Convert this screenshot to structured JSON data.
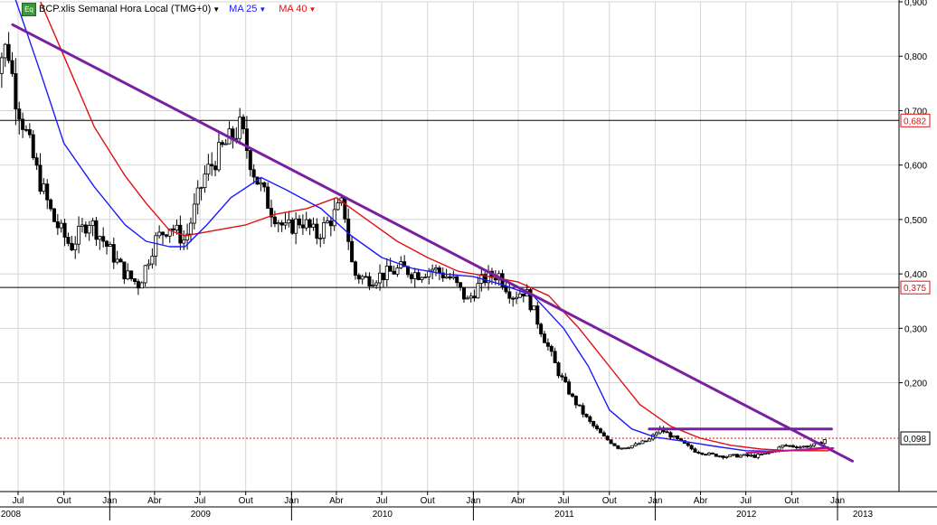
{
  "chart_data": {
    "type": "candlestick",
    "title": "BCP.xlis Semanal Hora Local (TMG+0)",
    "legend": [
      {
        "name": "MA 25",
        "color": "#1a1aff"
      },
      {
        "name": "MA 40",
        "color": "#e01010"
      }
    ],
    "ylim": [
      0.0,
      0.9
    ],
    "y_ticks": [
      "0,900",
      "0,800",
      "0,700",
      "0,600",
      "0,500",
      "0,400",
      "0,300",
      "0,200"
    ],
    "x_month_labels": [
      "Jul",
      "Out",
      "Jan",
      "Abr",
      "Jul",
      "Out",
      "Jan",
      "Abr",
      "Jul",
      "Out",
      "Jan",
      "Abr",
      "Jul",
      "Out",
      "Jan",
      "Abr",
      "Jul",
      "Out",
      "Jan"
    ],
    "x_year_labels": [
      "2008",
      "2009",
      "2010",
      "2011",
      "2012",
      "2013"
    ],
    "grid": true,
    "horizontal_levels": [
      {
        "value": 0.682,
        "label": "0,682",
        "style": "solid",
        "color": "#000000"
      },
      {
        "value": 0.375,
        "label": "0,375",
        "style": "solid",
        "color": "#000000"
      },
      {
        "value": 0.098,
        "label": "0,098",
        "style": "dotted",
        "color": "#e01010"
      }
    ],
    "trendlines": [
      {
        "name": "downtrend",
        "color": "#7a1fa0",
        "from": {
          "date": "2008-06-20",
          "value": 0.858
        },
        "to": {
          "date": "2013-01-31",
          "value": 0.056
        }
      },
      {
        "name": "resistance",
        "color": "#7a1fa0",
        "from": {
          "date": "2011-12-20",
          "value": 0.115
        },
        "to": {
          "date": "2012-12-20",
          "value": 0.115
        }
      }
    ],
    "close_path": [
      {
        "date": "2008-05-01",
        "value": 0.76
      },
      {
        "date": "2008-06-10",
        "value": 0.82
      },
      {
        "date": "2008-06-25",
        "value": 0.73
      },
      {
        "date": "2008-08-10",
        "value": 0.58
      },
      {
        "date": "2008-09-10",
        "value": 0.5
      },
      {
        "date": "2008-10-15",
        "value": 0.45
      },
      {
        "date": "2008-11-20",
        "value": 0.5
      },
      {
        "date": "2008-12-20",
        "value": 0.46
      },
      {
        "date": "2009-02-01",
        "value": 0.4
      },
      {
        "date": "2009-03-01",
        "value": 0.38
      },
      {
        "date": "2009-04-01",
        "value": 0.46
      },
      {
        "date": "2009-05-01",
        "value": 0.49
      },
      {
        "date": "2009-06-01",
        "value": 0.46
      },
      {
        "date": "2009-07-10",
        "value": 0.58
      },
      {
        "date": "2009-08-15",
        "value": 0.63
      },
      {
        "date": "2009-09-20",
        "value": 0.67
      },
      {
        "date": "2009-10-20",
        "value": 0.58
      },
      {
        "date": "2009-11-20",
        "value": 0.52
      },
      {
        "date": "2009-12-20",
        "value": 0.48
      },
      {
        "date": "2010-01-20",
        "value": 0.5
      },
      {
        "date": "2010-02-20",
        "value": 0.47
      },
      {
        "date": "2010-03-20",
        "value": 0.5
      },
      {
        "date": "2010-04-15",
        "value": 0.53
      },
      {
        "date": "2010-05-05",
        "value": 0.4
      },
      {
        "date": "2010-06-01",
        "value": 0.39
      },
      {
        "date": "2010-07-10",
        "value": 0.4
      },
      {
        "date": "2010-08-10",
        "value": 0.41
      },
      {
        "date": "2010-09-10",
        "value": 0.4
      },
      {
        "date": "2010-10-10",
        "value": 0.41
      },
      {
        "date": "2010-11-20",
        "value": 0.39
      },
      {
        "date": "2010-12-20",
        "value": 0.35
      },
      {
        "date": "2011-01-20",
        "value": 0.39
      },
      {
        "date": "2011-02-20",
        "value": 0.4
      },
      {
        "date": "2011-03-20",
        "value": 0.36
      },
      {
        "date": "2011-04-15",
        "value": 0.37
      },
      {
        "date": "2011-05-20",
        "value": 0.29
      },
      {
        "date": "2011-06-20",
        "value": 0.22
      },
      {
        "date": "2011-07-20",
        "value": 0.17
      },
      {
        "date": "2011-08-20",
        "value": 0.13
      },
      {
        "date": "2011-09-20",
        "value": 0.1
      },
      {
        "date": "2011-10-20",
        "value": 0.08
      },
      {
        "date": "2011-11-20",
        "value": 0.085
      },
      {
        "date": "2011-12-20",
        "value": 0.095
      },
      {
        "date": "2012-01-10",
        "value": 0.115
      },
      {
        "date": "2012-02-15",
        "value": 0.095
      },
      {
        "date": "2012-03-20",
        "value": 0.075
      },
      {
        "date": "2012-04-20",
        "value": 0.068
      },
      {
        "date": "2012-05-20",
        "value": 0.065
      },
      {
        "date": "2012-06-20",
        "value": 0.066
      },
      {
        "date": "2012-07-20",
        "value": 0.065
      },
      {
        "date": "2012-08-20",
        "value": 0.072
      },
      {
        "date": "2012-09-15",
        "value": 0.085
      },
      {
        "date": "2012-10-20",
        "value": 0.082
      },
      {
        "date": "2012-11-20",
        "value": 0.086
      },
      {
        "date": "2012-12-10",
        "value": 0.098
      }
    ],
    "ma25_path": [
      {
        "date": "2008-06-20",
        "value": 0.92
      },
      {
        "date": "2008-08-15",
        "value": 0.77
      },
      {
        "date": "2008-10-01",
        "value": 0.64
      },
      {
        "date": "2008-12-01",
        "value": 0.56
      },
      {
        "date": "2009-02-01",
        "value": 0.49
      },
      {
        "date": "2009-03-15",
        "value": 0.46
      },
      {
        "date": "2009-05-01",
        "value": 0.45
      },
      {
        "date": "2009-06-01",
        "value": 0.45
      },
      {
        "date": "2009-07-15",
        "value": 0.49
      },
      {
        "date": "2009-09-01",
        "value": 0.54
      },
      {
        "date": "2009-11-01",
        "value": 0.577
      },
      {
        "date": "2009-12-20",
        "value": 0.555
      },
      {
        "date": "2010-03-01",
        "value": 0.52
      },
      {
        "date": "2010-05-01",
        "value": 0.47
      },
      {
        "date": "2010-07-01",
        "value": 0.43
      },
      {
        "date": "2010-09-01",
        "value": 0.41
      },
      {
        "date": "2010-11-01",
        "value": 0.4
      },
      {
        "date": "2011-01-01",
        "value": 0.395
      },
      {
        "date": "2011-03-01",
        "value": 0.38
      },
      {
        "date": "2011-05-01",
        "value": 0.36
      },
      {
        "date": "2011-07-01",
        "value": 0.3
      },
      {
        "date": "2011-08-20",
        "value": 0.23
      },
      {
        "date": "2011-10-01",
        "value": 0.15
      },
      {
        "date": "2011-11-15",
        "value": 0.115
      },
      {
        "date": "2012-01-01",
        "value": 0.1
      },
      {
        "date": "2012-03-01",
        "value": 0.092
      },
      {
        "date": "2012-05-01",
        "value": 0.083
      },
      {
        "date": "2012-07-01",
        "value": 0.075
      },
      {
        "date": "2012-09-01",
        "value": 0.074
      },
      {
        "date": "2012-11-01",
        "value": 0.078
      },
      {
        "date": "2012-12-15",
        "value": 0.082
      }
    ],
    "ma40_path": [
      {
        "date": "2008-08-15",
        "value": 0.9
      },
      {
        "date": "2008-10-01",
        "value": 0.8
      },
      {
        "date": "2008-12-01",
        "value": 0.67
      },
      {
        "date": "2009-02-01",
        "value": 0.58
      },
      {
        "date": "2009-03-15",
        "value": 0.53
      },
      {
        "date": "2009-05-01",
        "value": 0.48
      },
      {
        "date": "2009-06-01",
        "value": 0.47
      },
      {
        "date": "2009-08-01",
        "value": 0.48
      },
      {
        "date": "2009-10-01",
        "value": 0.49
      },
      {
        "date": "2009-12-01",
        "value": 0.51
      },
      {
        "date": "2010-02-01",
        "value": 0.52
      },
      {
        "date": "2010-04-01",
        "value": 0.54
      },
      {
        "date": "2010-06-01",
        "value": 0.5
      },
      {
        "date": "2010-08-01",
        "value": 0.46
      },
      {
        "date": "2010-10-01",
        "value": 0.43
      },
      {
        "date": "2010-12-01",
        "value": 0.405
      },
      {
        "date": "2011-02-01",
        "value": 0.395
      },
      {
        "date": "2011-04-01",
        "value": 0.385
      },
      {
        "date": "2011-06-01",
        "value": 0.36
      },
      {
        "date": "2011-08-01",
        "value": 0.3
      },
      {
        "date": "2011-10-01",
        "value": 0.23
      },
      {
        "date": "2011-12-01",
        "value": 0.16
      },
      {
        "date": "2012-02-01",
        "value": 0.12
      },
      {
        "date": "2012-04-01",
        "value": 0.098
      },
      {
        "date": "2012-06-01",
        "value": 0.085
      },
      {
        "date": "2012-08-01",
        "value": 0.078
      },
      {
        "date": "2012-10-01",
        "value": 0.075
      },
      {
        "date": "2012-12-15",
        "value": 0.075
      }
    ]
  }
}
